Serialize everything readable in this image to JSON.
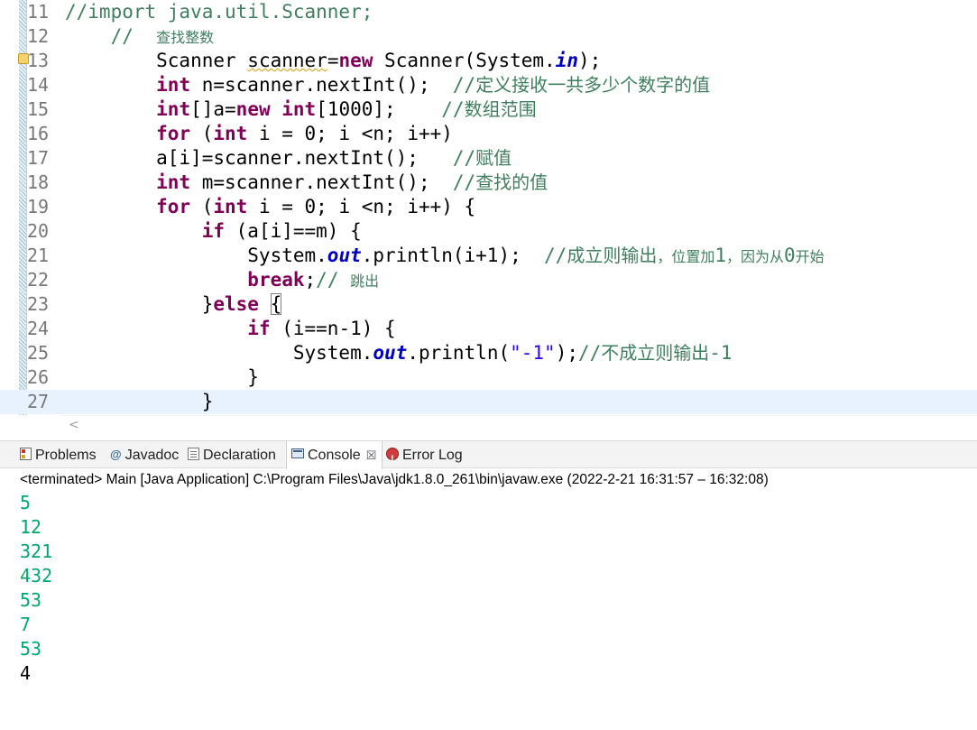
{
  "editor": {
    "lines": [
      {
        "num": "11",
        "segs": [
          [
            "cm",
            "//import java.util.Scanner;"
          ]
        ]
      },
      {
        "num": "12",
        "segs": [
          [
            "",
            "    "
          ],
          [
            "cm",
            "//  "
          ],
          [
            "cmsm",
            "查找整数"
          ]
        ]
      },
      {
        "num": "13",
        "segs": [
          [
            "",
            "        Scanner "
          ],
          [
            "squig",
            "scanner"
          ],
          [
            "",
            "="
          ],
          [
            "kw",
            "new"
          ],
          [
            "",
            " Scanner(System."
          ],
          [
            "fld",
            "in"
          ],
          [
            "",
            ");"
          ]
        ]
      },
      {
        "num": "14",
        "segs": [
          [
            "",
            "        "
          ],
          [
            "kw",
            "int"
          ],
          [
            "",
            " n=scanner.nextInt();  "
          ],
          [
            "cm",
            "//"
          ],
          [
            "cmcjk",
            "定义接收一共多少个数字的值"
          ]
        ]
      },
      {
        "num": "15",
        "segs": [
          [
            "",
            "        "
          ],
          [
            "kw",
            "int"
          ],
          [
            "",
            "[]a="
          ],
          [
            "kw",
            "new"
          ],
          [
            "",
            " "
          ],
          [
            "kw",
            "int"
          ],
          [
            "",
            "[1000];    "
          ],
          [
            "cm",
            "//"
          ],
          [
            "cmcjk",
            "数组范围"
          ]
        ]
      },
      {
        "num": "16",
        "segs": [
          [
            "",
            "        "
          ],
          [
            "kw",
            "for"
          ],
          [
            "",
            " ("
          ],
          [
            "kw",
            "int"
          ],
          [
            "",
            " i = 0; i <n; i++)"
          ]
        ]
      },
      {
        "num": "17",
        "segs": [
          [
            "",
            "        a[i]=scanner.nextInt();   "
          ],
          [
            "cm",
            "//"
          ],
          [
            "cmcjk",
            "赋值"
          ]
        ]
      },
      {
        "num": "18",
        "segs": [
          [
            "",
            "        "
          ],
          [
            "kw",
            "int"
          ],
          [
            "",
            " m=scanner.nextInt();  "
          ],
          [
            "cm",
            "//"
          ],
          [
            "cmcjk",
            "查找的值"
          ]
        ]
      },
      {
        "num": "19",
        "segs": [
          [
            "",
            "        "
          ],
          [
            "kw",
            "for"
          ],
          [
            "",
            " ("
          ],
          [
            "kw",
            "int"
          ],
          [
            "",
            " i = 0; i <n; i++) {"
          ]
        ]
      },
      {
        "num": "20",
        "segs": [
          [
            "",
            "            "
          ],
          [
            "kw",
            "if"
          ],
          [
            "",
            " (a[i]==m) {"
          ]
        ]
      },
      {
        "num": "21",
        "segs": [
          [
            "",
            "                System."
          ],
          [
            "fld",
            "out"
          ],
          [
            "",
            ".println(i+1);  "
          ],
          [
            "cm",
            "//"
          ],
          [
            "cmcjk",
            "成立则输出"
          ],
          [
            "cmsm",
            "，位置加"
          ],
          [
            "cm",
            "1"
          ],
          [
            "cmsm",
            "，因为从"
          ],
          [
            "cm",
            "0"
          ],
          [
            "cmsm",
            "开始"
          ]
        ]
      },
      {
        "num": "22",
        "segs": [
          [
            "",
            "                "
          ],
          [
            "kw",
            "break"
          ],
          [
            "",
            ";"
          ],
          [
            "cm",
            "// "
          ],
          [
            "cmsm",
            "跳出"
          ]
        ]
      },
      {
        "num": "23",
        "segs": [
          [
            "",
            "            }"
          ],
          [
            "kw",
            "else"
          ],
          [
            "",
            " "
          ],
          [
            "brace",
            "{"
          ]
        ]
      },
      {
        "num": "24",
        "segs": [
          [
            "",
            "                "
          ],
          [
            "kw",
            "if"
          ],
          [
            "",
            " (i==n-1) {"
          ]
        ]
      },
      {
        "num": "25",
        "segs": [
          [
            "",
            "                    System."
          ],
          [
            "fld",
            "out"
          ],
          [
            "",
            ".println("
          ],
          [
            "str",
            "\"-1\""
          ],
          [
            "",
            ");"
          ],
          [
            "cm",
            "//"
          ],
          [
            "cmcjk",
            "不成立则输出"
          ],
          [
            "cm",
            "-1"
          ]
        ]
      },
      {
        "num": "26",
        "segs": [
          [
            "",
            "                }"
          ]
        ]
      },
      {
        "num": "27",
        "segs": [
          [
            "",
            "            }"
          ]
        ],
        "current": true
      }
    ],
    "scroll_left_arrow": "<"
  },
  "tabs": [
    {
      "label": "Problems",
      "icon": "problems-icon"
    },
    {
      "label": "Javadoc",
      "icon": "javadoc-icon",
      "glyph": "@"
    },
    {
      "label": "Declaration",
      "icon": "declaration-icon"
    },
    {
      "label": "Console",
      "icon": "console-icon",
      "close": "☒",
      "active": true
    },
    {
      "label": "Error Log",
      "icon": "error-log-icon"
    }
  ],
  "console": {
    "status": "<terminated> Main [Java Application] C:\\Program Files\\Java\\jdk1.8.0_261\\bin\\javaw.exe  (2022-2-21 16:31:57 – 16:32:08)",
    "lines": [
      {
        "text": "5",
        "kind": "input"
      },
      {
        "text": "12",
        "kind": "input"
      },
      {
        "text": "321",
        "kind": "input"
      },
      {
        "text": "432",
        "kind": "input"
      },
      {
        "text": "53",
        "kind": "input"
      },
      {
        "text": "7",
        "kind": "input"
      },
      {
        "text": "53",
        "kind": "input"
      },
      {
        "text": "4",
        "kind": "output"
      }
    ]
  },
  "colors": {
    "keyword": "#7f0055",
    "comment": "#3f7f5f",
    "field": "#0000c0",
    "string": "#2a00ff",
    "console_input": "#00a86b",
    "current_line": "#e8f2fe"
  }
}
